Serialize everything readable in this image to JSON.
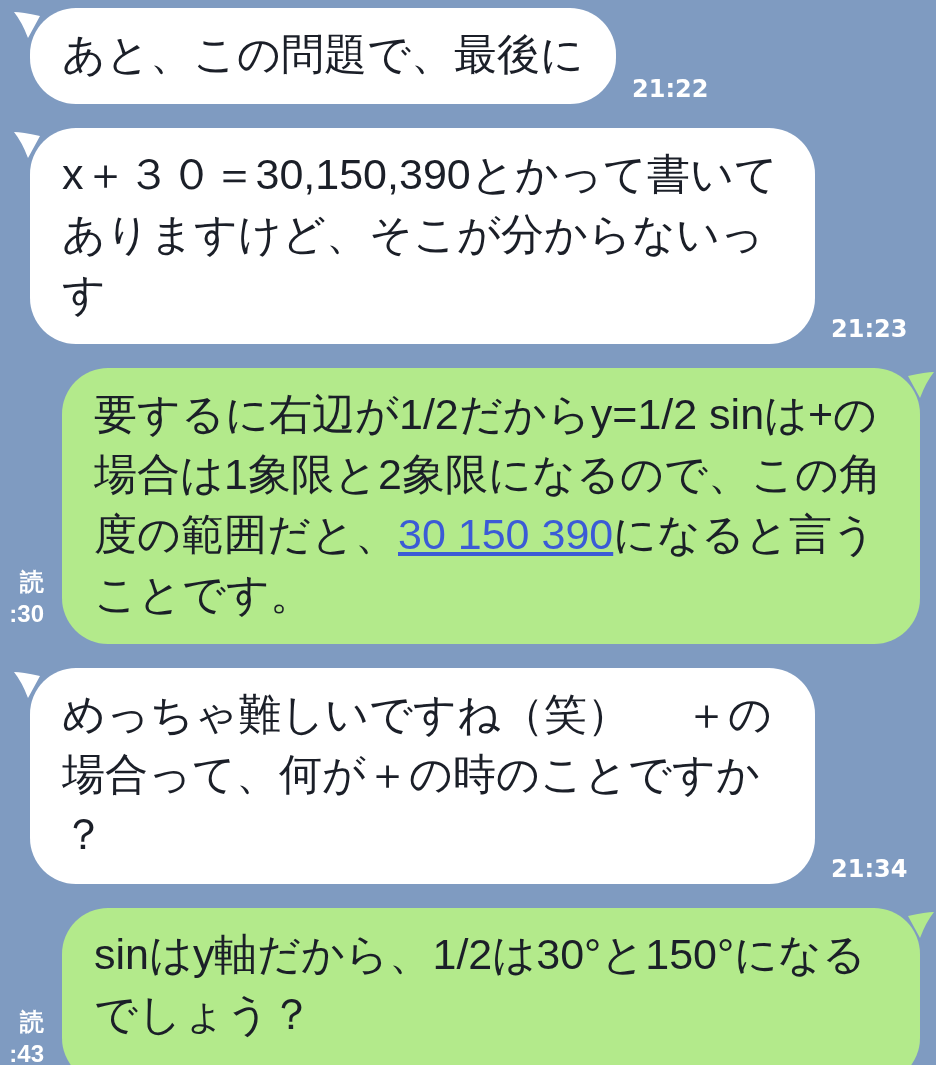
{
  "messages": [
    {
      "kind": "incoming",
      "body": [
        {
          "text": "あと、この問題で、最後に"
        }
      ],
      "time": "21:22"
    },
    {
      "kind": "incoming",
      "body": [
        {
          "text": "x＋３０＝30,150,390とかって書いてありますけど、そこが分からないっす"
        }
      ],
      "time": "21:23"
    },
    {
      "kind": "outgoing",
      "body": [
        {
          "text": "要するに右辺が1/2だからy=1/2 sinは+の場合は1象限と2象限になるので、この角度の範囲だと、"
        },
        {
          "link": "30 150 390"
        },
        {
          "text": "になると言うことです。"
        }
      ],
      "read": "読",
      "time": ":30"
    },
    {
      "kind": "incoming",
      "body": [
        {
          "text": "めっちゃ難しいですね（笑）　 ＋の場合って、何が＋の時のことですか？"
        }
      ],
      "time": "21:34"
    },
    {
      "kind": "outgoing",
      "body": [
        {
          "text": "sinはy軸だから、1/2は30°と150°になるでしょう？"
        }
      ],
      "read": "読",
      "time": ":43"
    }
  ]
}
